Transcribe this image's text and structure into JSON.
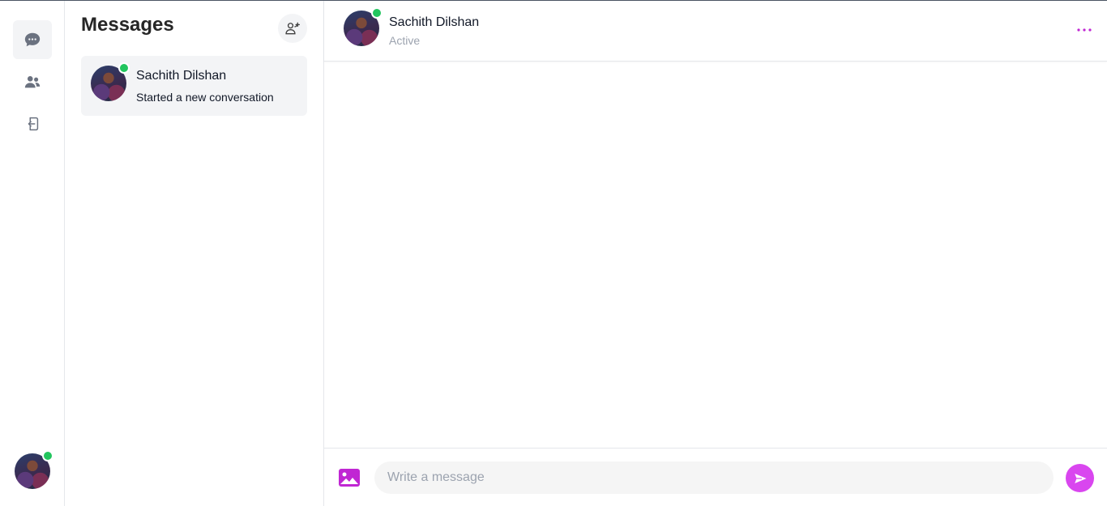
{
  "nav": {
    "items": [
      {
        "icon": "chat-bubble-icon",
        "active": true
      },
      {
        "icon": "users-icon",
        "active": false
      },
      {
        "icon": "logout-icon",
        "active": false
      }
    ],
    "current_user": {
      "online": true
    }
  },
  "conversations": {
    "title": "Messages",
    "add_icon": "add-user-icon",
    "items": [
      {
        "name": "Sachith Dilshan",
        "preview": "Started a new conversation",
        "online": true,
        "selected": true
      }
    ]
  },
  "chat": {
    "contact_name": "Sachith Dilshan",
    "status": "Active",
    "menu_icon": "more-dots-icon",
    "composer": {
      "placeholder": "Write a message",
      "value": "",
      "image_icon": "image-icon",
      "send_icon": "send-icon"
    }
  },
  "colors": {
    "accent": "#d946ef",
    "online": "#22c55e",
    "selected_bg": "#f3f4f6",
    "border": "#e5e7eb"
  }
}
